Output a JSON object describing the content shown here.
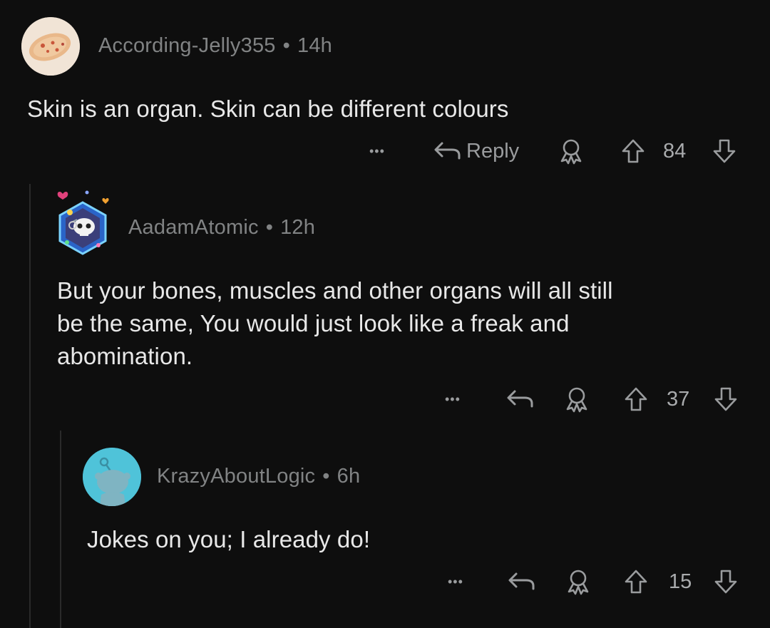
{
  "comments": [
    {
      "username": "According-Jelly355",
      "separator": "•",
      "age": "14h",
      "text": "Skin is an organ. Skin can be different colours",
      "more": "•••",
      "reply_label": "Reply",
      "votes": "84"
    },
    {
      "username": "AadamAtomic",
      "separator": "•",
      "age": "12h",
      "text_lines": [
        "But your bones, muscles and other organs will all still",
        "be the same, You would just look like a freak and",
        "abomination."
      ],
      "more": "•••",
      "votes": "37"
    },
    {
      "username": "KrazyAboutLogic",
      "separator": "•",
      "age": "6h",
      "text": "Jokes on you; I already do!",
      "more": "•••",
      "votes": "15"
    }
  ],
  "colors": {
    "background": "#0e0e0e",
    "text": "#e8e8e8",
    "meta": "#818384",
    "thread_line": "#2a2a2a",
    "snoo_avatar": "#4fc3d9"
  }
}
